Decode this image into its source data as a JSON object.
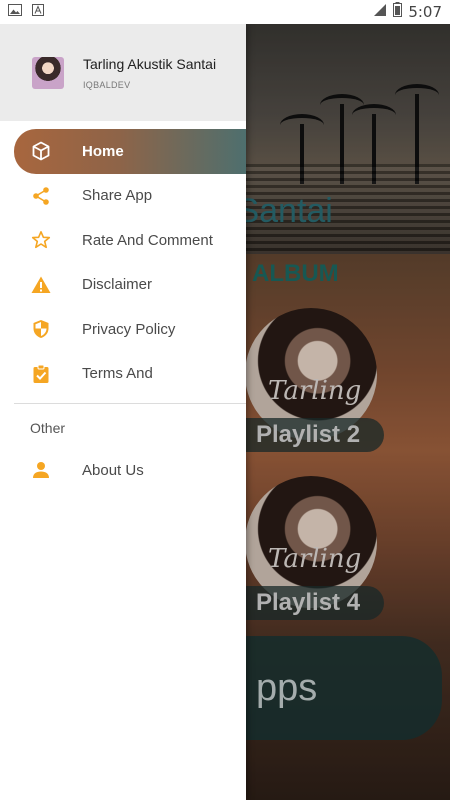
{
  "status_bar": {
    "time": "5:07",
    "left_icons": [
      "image-icon",
      "text-a-icon"
    ],
    "right_icons": [
      "signal-icon",
      "battery-icon"
    ]
  },
  "background_app": {
    "title_fragment": "k Santai",
    "section_label": "ALBUM",
    "disc_text": "Tarling",
    "playlists": [
      "Playlist 2",
      "Playlist 4"
    ],
    "bottom_button_fragment": "pps"
  },
  "drawer": {
    "header": {
      "title": "Tarling Akustik Santai",
      "subtitle": "IQBALDEV"
    },
    "items": [
      {
        "label": "Home",
        "icon": "cube-icon",
        "active": true
      },
      {
        "label": "Share App",
        "icon": "share-icon"
      },
      {
        "label": "Rate And Comment",
        "icon": "star-icon"
      },
      {
        "label": "Disclaimer",
        "icon": "warning-icon"
      },
      {
        "label": "Privacy Policy",
        "icon": "shield-icon"
      },
      {
        "label": "Terms And",
        "icon": "clipboard-check-icon"
      }
    ],
    "section_title": "Other",
    "other_items": [
      {
        "label": "About Us",
        "icon": "person-icon"
      }
    ]
  },
  "colors": {
    "accent_orange": "#f5a623",
    "active_gradient_start": "#a8663e",
    "active_gradient_end": "#4e6f6e"
  }
}
